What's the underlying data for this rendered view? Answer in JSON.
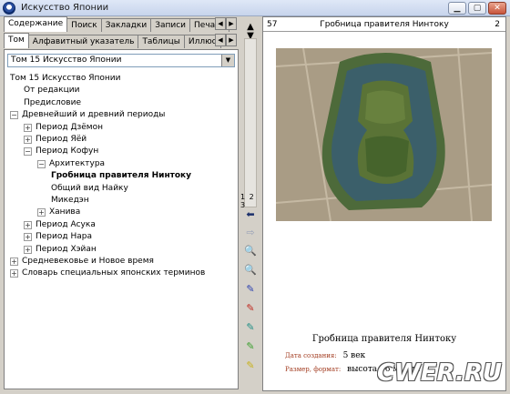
{
  "window": {
    "title": "Искусство Японии"
  },
  "tabs_top": [
    {
      "label": "Содержание",
      "active": true
    },
    {
      "label": "Поиск"
    },
    {
      "label": "Закладки"
    },
    {
      "label": "Записи"
    },
    {
      "label": "Печать"
    }
  ],
  "tabs_bottom": [
    {
      "label": "Том",
      "active": true
    },
    {
      "label": "Алфавитный указатель"
    },
    {
      "label": "Таблицы"
    },
    {
      "label": "Иллюс"
    }
  ],
  "volume_select": {
    "value": "Том 15 Искусство Японии"
  },
  "tree": [
    {
      "label": "Том 15 Искусство Японии",
      "level": 0,
      "toggle": ""
    },
    {
      "label": "От редакции",
      "level": 1,
      "toggle": ""
    },
    {
      "label": "Предисловие",
      "level": 1,
      "toggle": ""
    },
    {
      "label": "Древнейший и древний периоды",
      "level": 0,
      "toggle": "−"
    },
    {
      "label": "Период Дзёмон",
      "level": 1,
      "toggle": "+"
    },
    {
      "label": "Период Яёй",
      "level": 1,
      "toggle": "+"
    },
    {
      "label": "Период Кофун",
      "level": 1,
      "toggle": "−"
    },
    {
      "label": "Архитектура",
      "level": 2,
      "toggle": "−"
    },
    {
      "label": "Гробница правителя Нинтоку",
      "level": 3,
      "toggle": "",
      "bold": true
    },
    {
      "label": "Общий вид Найку",
      "level": 3,
      "toggle": ""
    },
    {
      "label": "Микедэн",
      "level": 3,
      "toggle": ""
    },
    {
      "label": "Ханива",
      "level": 2,
      "toggle": "+"
    },
    {
      "label": "Период Асука",
      "level": 1,
      "toggle": "+"
    },
    {
      "label": "Период Нара",
      "level": 1,
      "toggle": "+"
    },
    {
      "label": "Период Хэйан",
      "level": 1,
      "toggle": "+"
    },
    {
      "label": "Средневековье и Новое время",
      "level": 0,
      "toggle": "+"
    },
    {
      "label": "Словарь специальных японских терминов",
      "level": 0,
      "toggle": "+"
    }
  ],
  "toolbar": {
    "page_indicator": "1 2 3",
    "icons": [
      "arrow-back-icon",
      "arrow-forward-icon",
      "zoom-out-icon",
      "zoom-in-icon",
      "pen-blue-icon",
      "pen-red-icon",
      "pen-teal-icon",
      "pen-green-icon",
      "pen-yellow-icon"
    ]
  },
  "page": {
    "number_left": "57",
    "number_right": "2",
    "title": "Гробница правителя Нинтоку",
    "caption": "Гробница правителя Нинтоку",
    "date_label": "Дата создания:",
    "date_value": "5 век",
    "size_label": "Размер, формат:",
    "size_value": "высота 36 м, дли"
  },
  "watermark": "CWER.RU",
  "colors": {
    "moat": "#3b5f6a",
    "island": "#4f6b32",
    "ground": "#b7a690",
    "accent_label": "#a23b1f"
  }
}
